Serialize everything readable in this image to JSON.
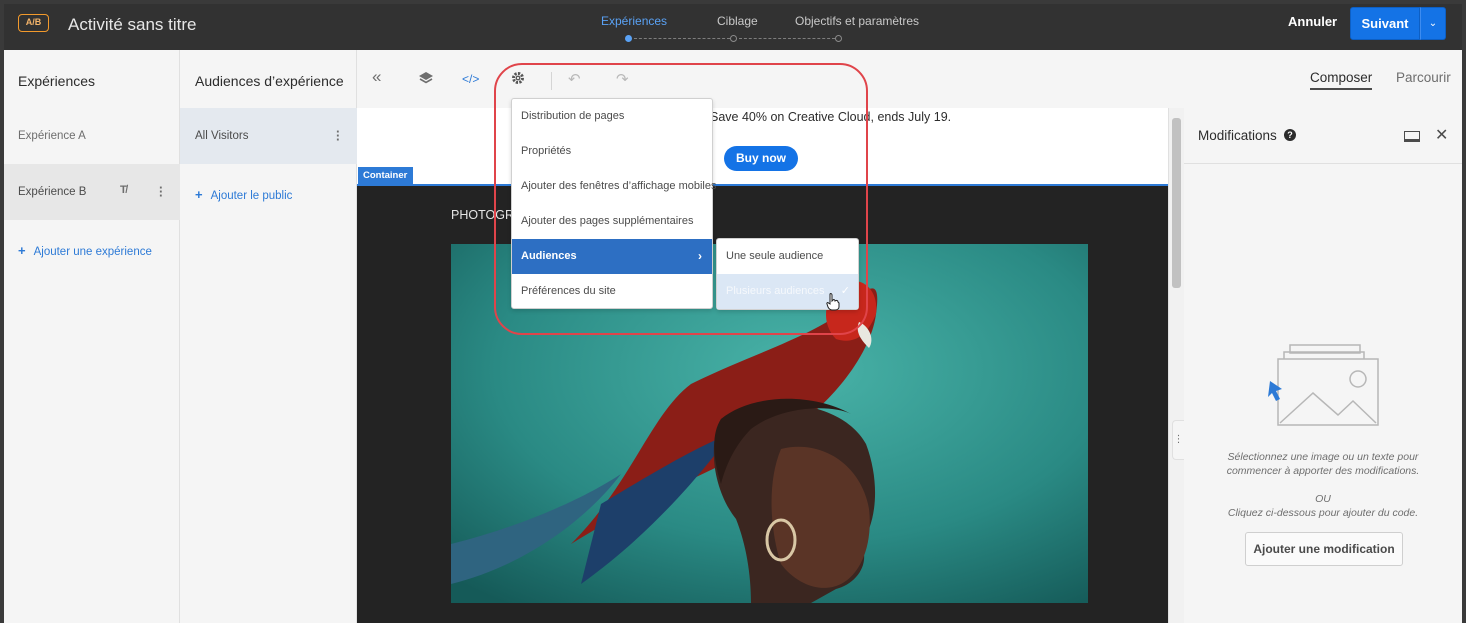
{
  "app": {
    "badge": "A/B",
    "title": "Activité sans titre"
  },
  "steps": [
    {
      "label": "Expériences",
      "active": true
    },
    {
      "label": "Ciblage",
      "active": false
    },
    {
      "label": "Objectifs et paramètres",
      "active": false
    }
  ],
  "header_actions": {
    "cancel": "Annuler",
    "next": "Suivant"
  },
  "experiences_panel": {
    "title": "Expériences",
    "items": [
      {
        "label": "Expérience A",
        "selected": false
      },
      {
        "label": "Expérience B",
        "selected": true
      }
    ],
    "add_label": "Ajouter une expérience"
  },
  "audiences_panel": {
    "title": "Audiences d’expérience",
    "items": [
      {
        "label": "All Visitors"
      }
    ],
    "add_label": "Ajouter le public"
  },
  "toolbar": {
    "icons": [
      "collapse-icon",
      "layers-icon",
      "code-icon",
      "settings-gear-icon",
      "undo-icon",
      "redo-icon"
    ],
    "tabs": [
      {
        "label": "Composer",
        "active": true
      },
      {
        "label": "Parcourir",
        "active": false
      }
    ]
  },
  "settings_menu": {
    "items": [
      {
        "label": "Distribution de pages"
      },
      {
        "label": "Propriétés"
      },
      {
        "label": "Ajouter des fenêtres d’affichage mobiles"
      },
      {
        "label": "Ajouter des pages supplémentaires"
      },
      {
        "label": "Audiences",
        "highlighted": true,
        "has_submenu": true
      },
      {
        "label": "Préférences du site"
      }
    ],
    "submenu": [
      {
        "label": "Une seule audience"
      },
      {
        "label": "Plusieurs audiences",
        "hover": true,
        "checked": true
      }
    ]
  },
  "canvas": {
    "banner_text": "Save 40% on Creative Cloud, ends July 19.",
    "banner_button": "Buy now",
    "container_tag": "Container",
    "section_label": "PHOTOGR"
  },
  "modifications_panel": {
    "title": "Modifications",
    "empty_line1": "Sélectionnez une image ou un texte pour",
    "empty_line2": "commencer à apporter des modifications.",
    "or": "OU",
    "empty_line3": "Cliquez ci-dessous pour ajouter du code.",
    "add_button": "Ajouter une modification"
  },
  "colors": {
    "accent": "#1473e6",
    "menu_highlight": "#2d6fc3",
    "ring": "#e0444a"
  }
}
